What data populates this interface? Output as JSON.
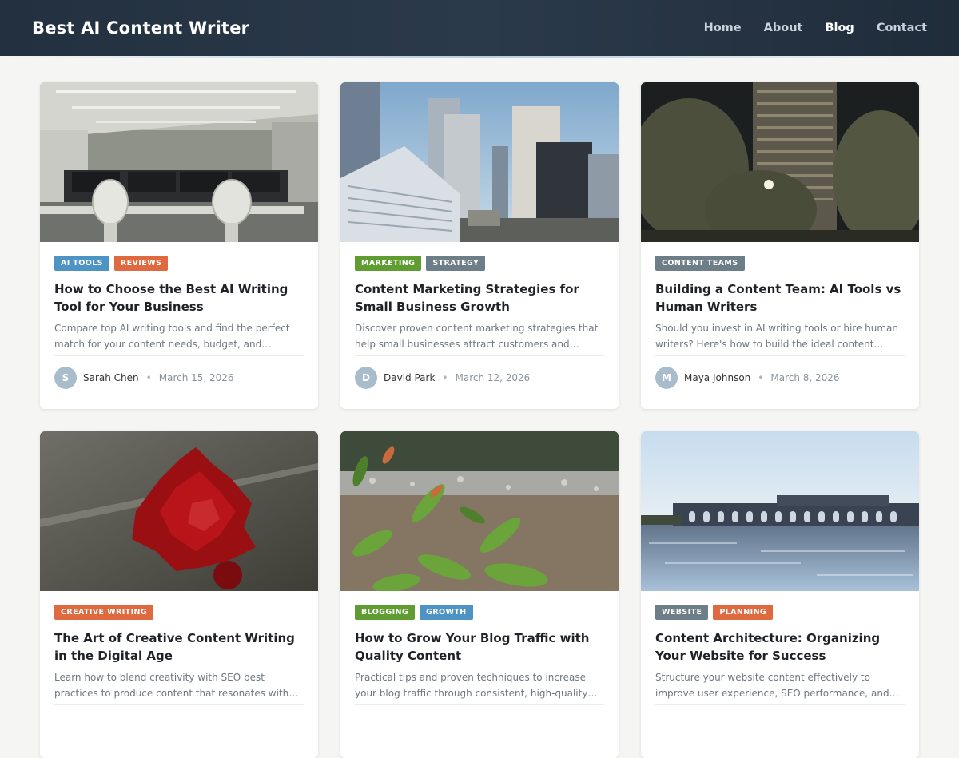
{
  "site": {
    "title": "Best AI Content Writer"
  },
  "nav": [
    {
      "label": "Home",
      "active": false
    },
    {
      "label": "About",
      "active": false
    },
    {
      "label": "Blog",
      "active": true
    },
    {
      "label": "Contact",
      "active": false
    }
  ],
  "colors": {
    "header": "#22303f",
    "tag_blue": "#4d93c4",
    "tag_orange": "#e06a3f",
    "tag_green": "#5f9d33",
    "tag_slate": "#6e7e88",
    "avatar": "#a9bccb"
  },
  "posts": [
    {
      "image": "office-interior-photo",
      "tags": [
        {
          "label": "AI TOOLS",
          "color": "#4d93c4"
        },
        {
          "label": "REVIEWS",
          "color": "#e06a3f"
        }
      ],
      "title": "How to Choose the Best AI Writing Tool for Your Business",
      "excerpt": "Compare top AI writing tools and find the perfect match for your content needs, budget, and workflow...",
      "author_initial": "S",
      "author": "Sarah Chen",
      "date": "March 15, 2026"
    },
    {
      "image": "city-skyline-photo",
      "tags": [
        {
          "label": "MARKETING",
          "color": "#5f9d33"
        },
        {
          "label": "STRATEGY",
          "color": "#6e7e88"
        }
      ],
      "title": "Content Marketing Strategies for Small Business Growth",
      "excerpt": "Discover proven content marketing strategies that help small businesses attract customers and build...",
      "author_initial": "D",
      "author": "David Park",
      "date": "March 12, 2026"
    },
    {
      "image": "night-tower-trees-photo",
      "tags": [
        {
          "label": "CONTENT TEAMS",
          "color": "#6e7e88"
        }
      ],
      "title": "Building a Content Team: AI Tools vs Human Writers",
      "excerpt": "Should you invest in AI writing tools or hire human writers? Here's how to build the ideal content team...",
      "author_initial": "M",
      "author": "Maya Johnson",
      "date": "March 8, 2026"
    },
    {
      "image": "red-flower-on-road-photo",
      "tags": [
        {
          "label": "CREATIVE WRITING",
          "color": "#e06a3f"
        }
      ],
      "title": "The Art of Creative Content Writing in the Digital Age",
      "excerpt": "Learn how to blend creativity with SEO best practices to produce content that resonates with readers and...",
      "author_initial": "",
      "author": "",
      "date": ""
    },
    {
      "image": "green-plants-photo",
      "tags": [
        {
          "label": "BLOGGING",
          "color": "#5f9d33"
        },
        {
          "label": "GROWTH",
          "color": "#4d93c4"
        }
      ],
      "title": "How to Grow Your Blog Traffic with Quality Content",
      "excerpt": "Practical tips and proven techniques to increase your blog traffic through consistent, high-quality content...",
      "author_initial": "",
      "author": "",
      "date": ""
    },
    {
      "image": "bridge-over-river-photo",
      "tags": [
        {
          "label": "WEBSITE",
          "color": "#6e7e88"
        },
        {
          "label": "PLANNING",
          "color": "#e06a3f"
        }
      ],
      "title": "Content Architecture: Organizing Your Website for Success",
      "excerpt": "Structure your website content effectively to improve user experience, SEO performance, and conversion...",
      "author_initial": "",
      "author": "",
      "date": ""
    }
  ]
}
